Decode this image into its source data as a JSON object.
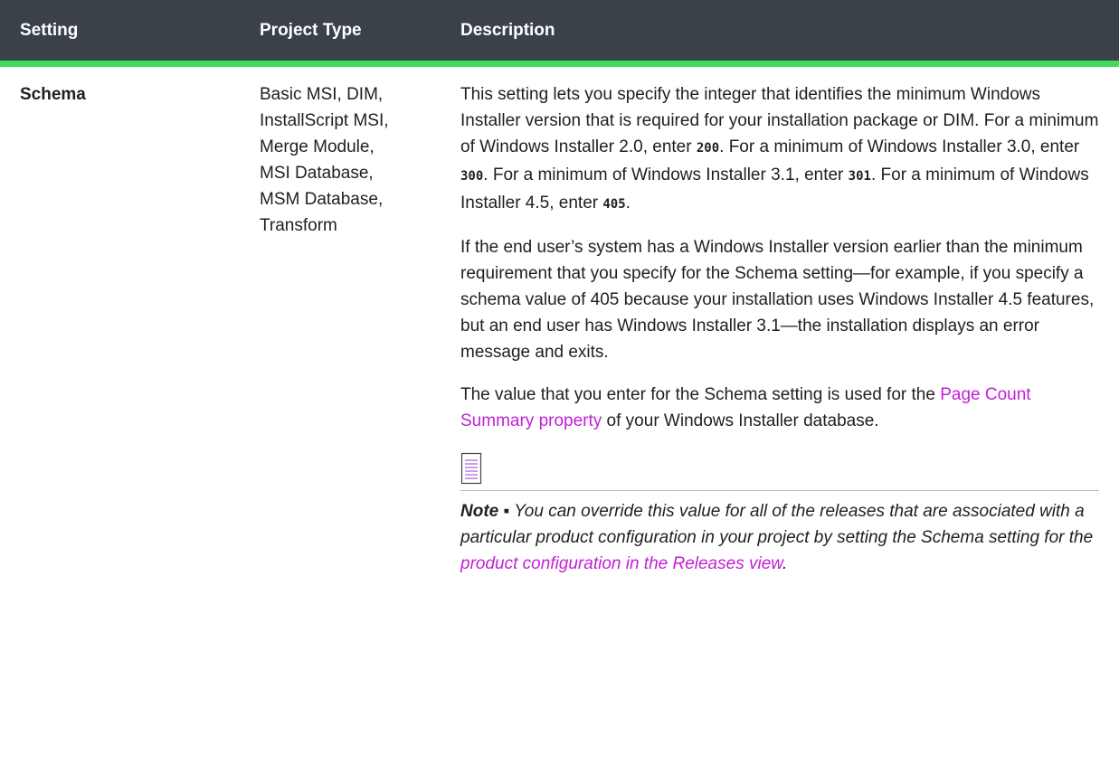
{
  "header": {
    "col1": "Setting",
    "col2": "Project Type",
    "col3": "Description"
  },
  "row": {
    "setting": "Schema",
    "project_types": [
      "Basic MSI, DIM,",
      "InstallScript MSI,",
      "Merge Module,",
      "MSI Database,",
      "MSM Database,",
      "Transform"
    ],
    "p1": {
      "t1": "This setting lets you specify the integer that identifies the minimum Windows Installer version that is required for your installation package or DIM. For a minimum of Windows Installer 2.0, enter ",
      "c1": "200",
      "t2": ". For a minimum of Windows Installer 3.0, enter ",
      "c2": "300",
      "t3": ". For a minimum of Windows Installer 3.1, enter ",
      "c3": "301",
      "t4": ". For a minimum of Windows Installer 4.5, enter ",
      "c4": "405",
      "t5": "."
    },
    "p2": "If the end user’s system has a Windows Installer version earlier than the minimum requirement that you specify for the Schema setting—for example, if you specify a schema value of 405 because your installation uses Windows Installer 4.5 features, but an end user has Windows Installer 3.1—the installation displays an error message and exits.",
    "p3": {
      "t1": "The value that you enter for the Schema setting is used for the ",
      "link": "Page Count Summary property",
      "t2": " of your Windows Installer database."
    },
    "note": {
      "icon": "note-icon",
      "label": "Note",
      "bullet": " ▪ ",
      "t1": "You can override this value for all of the releases that are associated with a particular product configuration in your project by setting the Schema setting for the ",
      "link": "product configuration in the Releases view",
      "t2": "."
    }
  },
  "colors": {
    "header_bg": "#3a4149",
    "header_accent": "#3ddc5c",
    "link": "#c21fd6"
  }
}
